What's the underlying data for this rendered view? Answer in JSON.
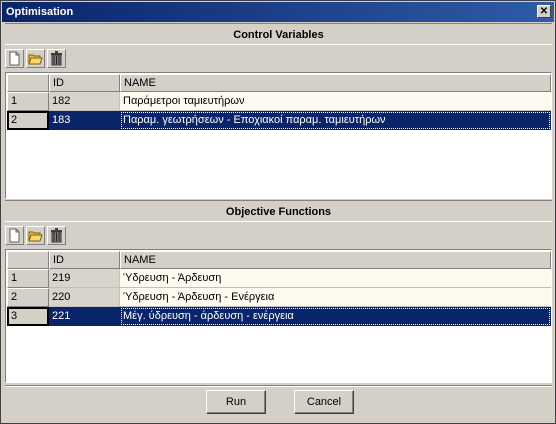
{
  "window": {
    "title": "Optimisation"
  },
  "control_variables": {
    "header": "Control Variables",
    "toolbar": [
      "new-icon",
      "open-folder-icon",
      "trash-icon"
    ],
    "columns": {
      "id": "ID",
      "name": "NAME"
    },
    "rows": [
      {
        "num": "1",
        "id": "182",
        "name": "Παράμετροι ταμιευτήρων",
        "selected": false
      },
      {
        "num": "2",
        "id": "183",
        "name": "Παραμ. γεωτρήσεων - Εποχιακοί παραμ. ταμιευτήρων",
        "selected": true
      }
    ]
  },
  "objective_functions": {
    "header": "Objective Functions",
    "toolbar": [
      "new-icon",
      "open-folder-icon",
      "trash-icon"
    ],
    "columns": {
      "id": "ID",
      "name": "NAME"
    },
    "rows": [
      {
        "num": "1",
        "id": "219",
        "name": "Ύδρευση - Άρδευση",
        "selected": false
      },
      {
        "num": "2",
        "id": "220",
        "name": "Ύδρευση - Άρδευση - Ενέργεια",
        "selected": false
      },
      {
        "num": "3",
        "id": "221",
        "name": "Μέγ. ύδρευση - άρδευση - ενέργεια",
        "selected": true
      }
    ]
  },
  "buttons": {
    "run": "Run",
    "cancel": "Cancel"
  },
  "colors": {
    "titlebar": "#0a246a",
    "selection": "#0a246a",
    "face": "#d4d0c8",
    "cell_bg": "#fffaf0"
  }
}
